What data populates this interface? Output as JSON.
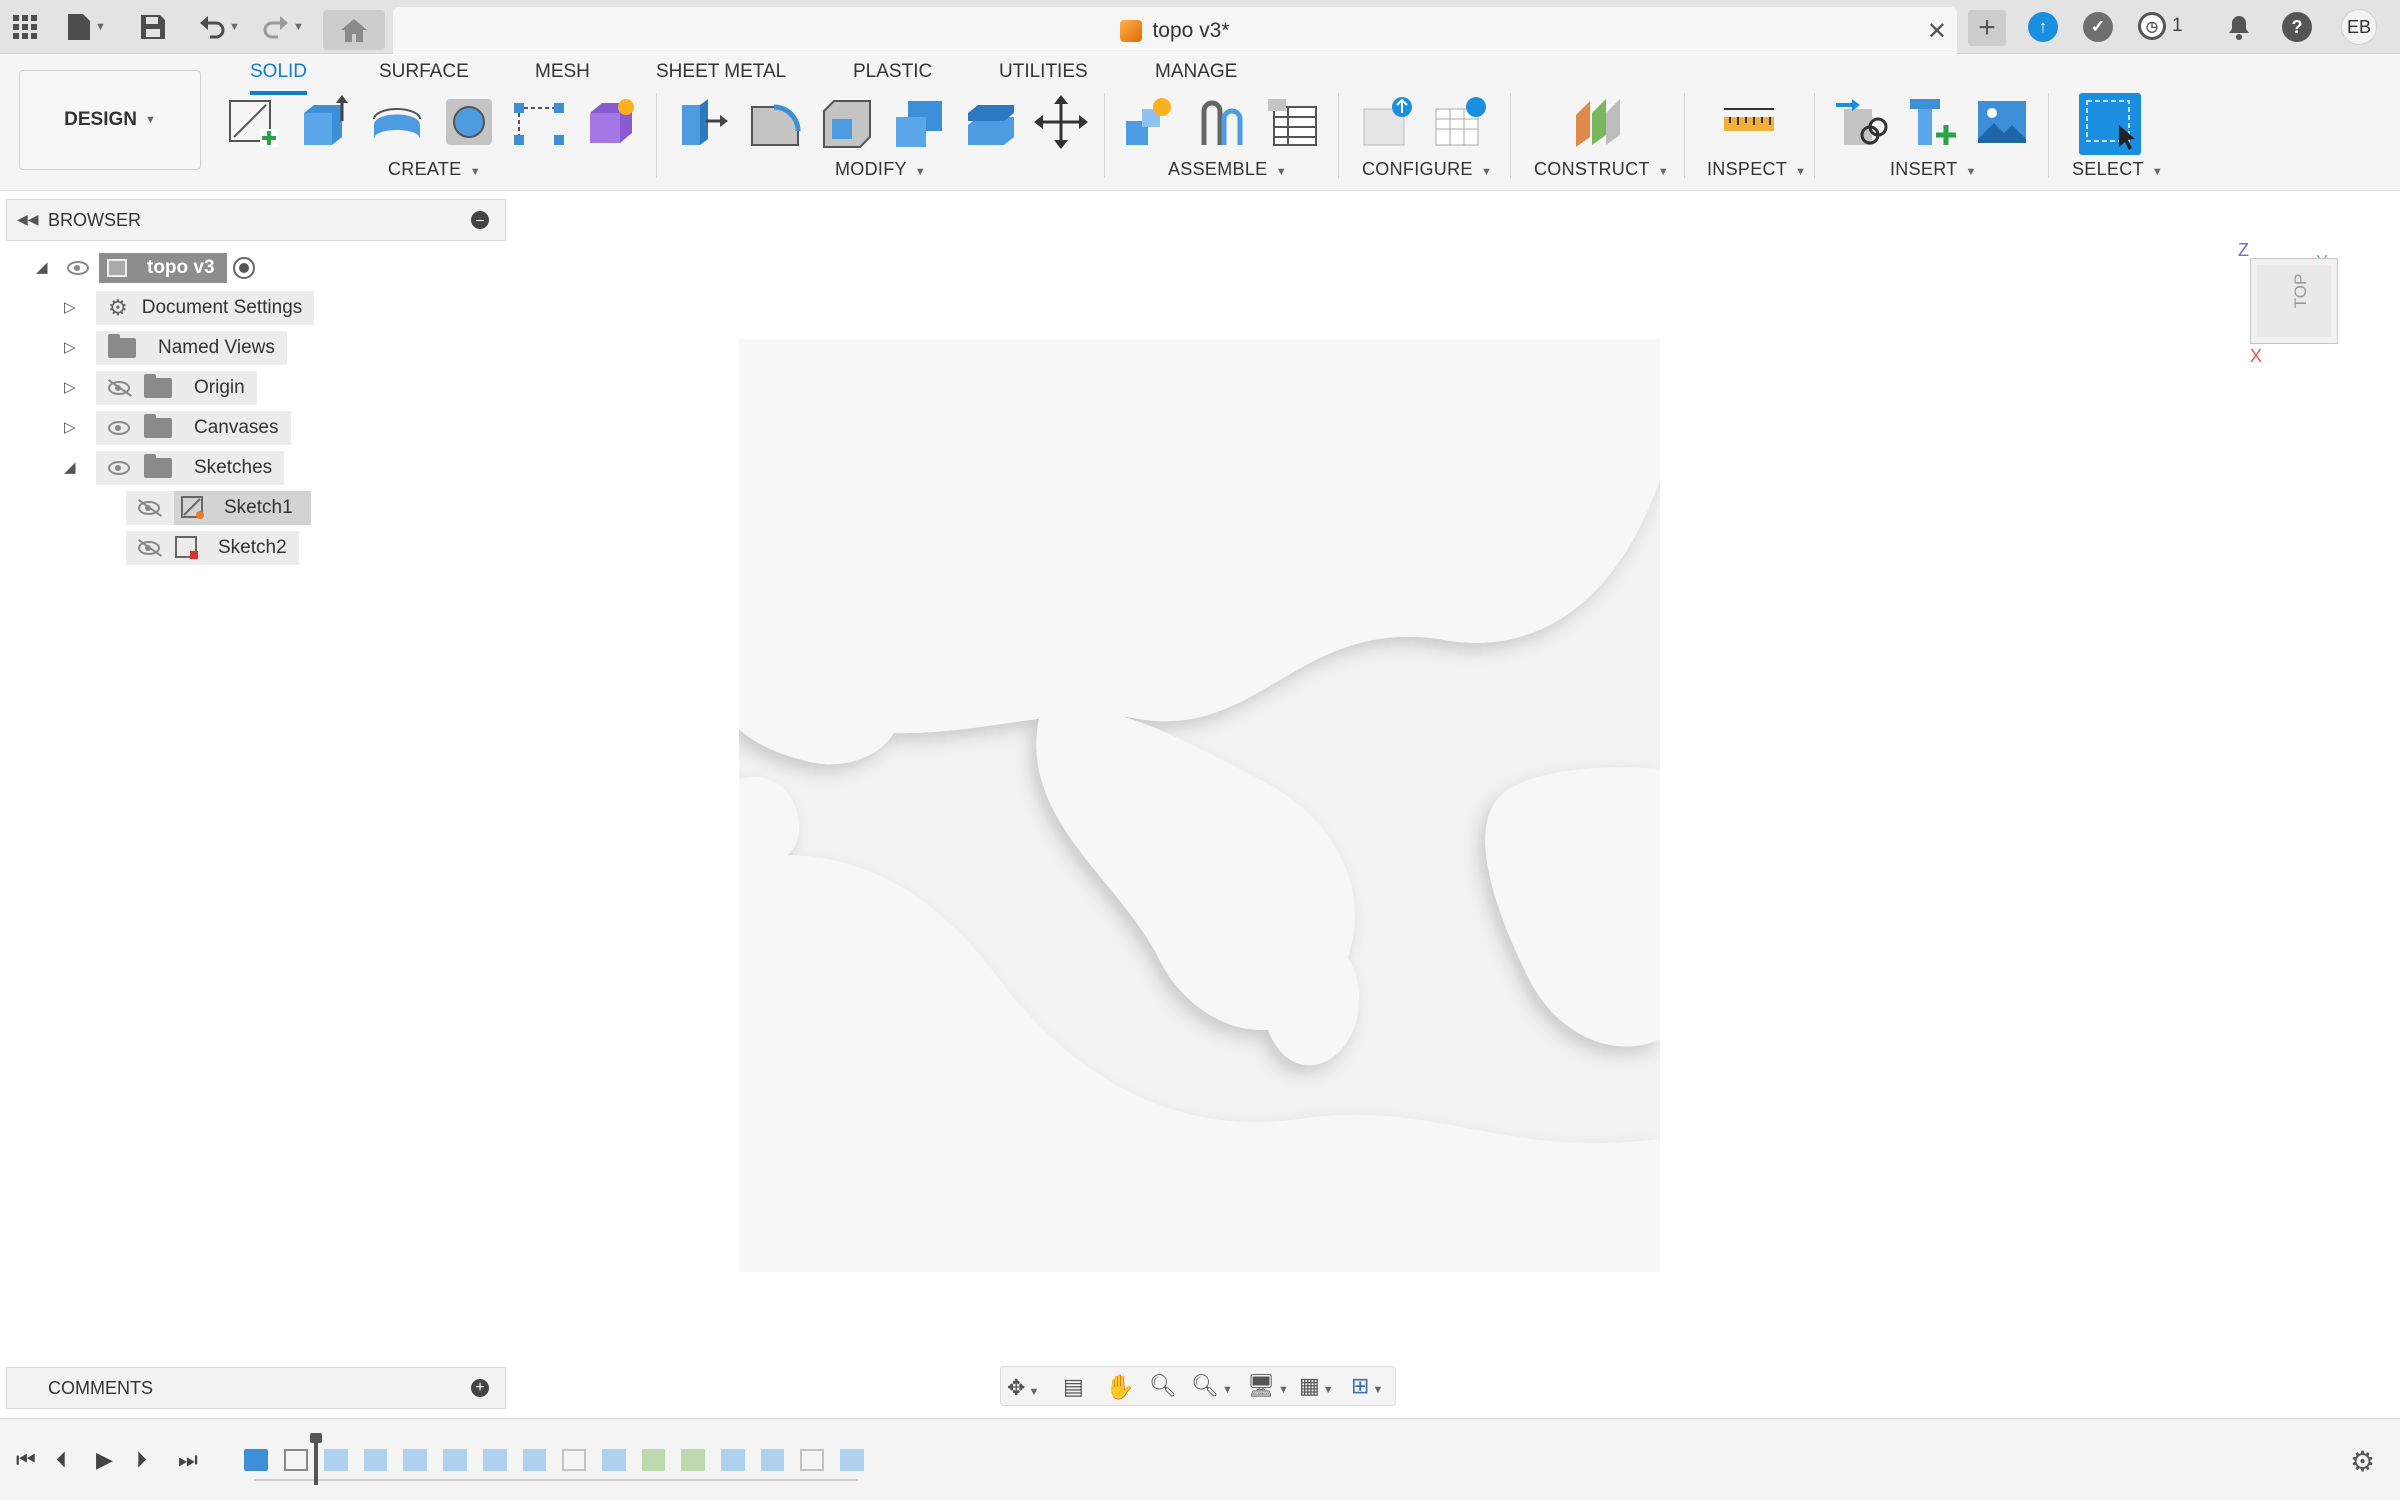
{
  "window": {
    "title": "topo v3*",
    "notification_count": "1",
    "user_initials": "EB"
  },
  "toolbar": {
    "workspace": "DESIGN",
    "tabs": [
      "SOLID",
      "SURFACE",
      "MESH",
      "SHEET METAL",
      "PLASTIC",
      "UTILITIES",
      "MANAGE"
    ],
    "active_tab": "SOLID",
    "groups": {
      "create": "CREATE",
      "modify": "MODIFY",
      "assemble": "ASSEMBLE",
      "configure": "CONFIGURE",
      "construct": "CONSTRUCT",
      "inspect": "INSPECT",
      "insert": "INSERT",
      "select": "SELECT"
    }
  },
  "browser": {
    "title": "BROWSER",
    "root": "topo v3",
    "items": [
      {
        "label": "Document Settings",
        "icon": "gear-icon"
      },
      {
        "label": "Named Views",
        "icon": "folder-icon"
      },
      {
        "label": "Origin",
        "icon": "folder-icon"
      },
      {
        "label": "Canvases",
        "icon": "folder-icon"
      },
      {
        "label": "Sketches",
        "icon": "folder-icon"
      },
      {
        "label": "Sketch1",
        "icon": "sketch-icon"
      },
      {
        "label": "Sketch2",
        "icon": "sketch-icon"
      }
    ]
  },
  "viewcube": {
    "face": "TOP",
    "axis_z": "Z",
    "axis_y": "Y",
    "axis_x": "X"
  },
  "comments": {
    "title": "COMMENTS"
  },
  "colors": {
    "accent": "#0e7ccf",
    "select_blue": "#1a8fe0",
    "model_bg": "#f2f2f2"
  }
}
